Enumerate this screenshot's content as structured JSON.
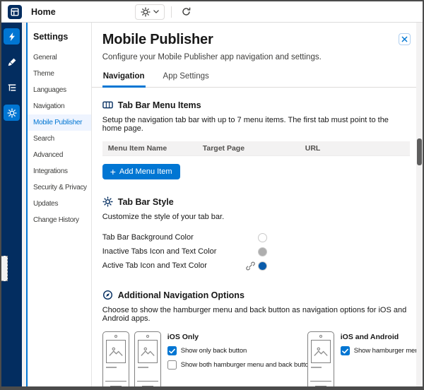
{
  "colors": {
    "brand_blue": "#0176D3",
    "navy": "#032D60",
    "selected_item_bg": "#EEF4FF"
  },
  "icons": {
    "plus": "+",
    "builder_logo": "grid-square",
    "topbar": [
      "gear",
      "chevron-down",
      "refresh-arrow"
    ],
    "rail": [
      "lightning",
      "brush",
      "page-structure",
      "gear"
    ],
    "sections": [
      "tab-bar",
      "gear-sun",
      "compass"
    ],
    "link": "chain",
    "close": "x"
  },
  "top_bar": {
    "home_label": "Home"
  },
  "sidebar": {
    "title": "Settings",
    "items": [
      {
        "label": "General"
      },
      {
        "label": "Theme"
      },
      {
        "label": "Languages"
      },
      {
        "label": "Navigation"
      },
      {
        "label": "Mobile Publisher",
        "active": true
      },
      {
        "label": "Search"
      },
      {
        "label": "Advanced"
      },
      {
        "label": "Integrations"
      },
      {
        "label": "Security & Privacy"
      },
      {
        "label": "Updates"
      },
      {
        "label": "Change History"
      }
    ]
  },
  "main": {
    "title": "Mobile Publisher",
    "subtitle": "Configure your Mobile Publisher app navigation and settings.",
    "tabs": [
      {
        "label": "Navigation",
        "active": true
      },
      {
        "label": "App Settings",
        "active": false
      }
    ],
    "menu_items_section": {
      "heading": "Tab Bar Menu Items",
      "description": "Setup the navigation tab bar with up to 7 menu items. The first tab must point to the home page.",
      "columns": [
        "Menu Item Name",
        "Target Page",
        "URL"
      ],
      "add_button_label": "Add Menu Item"
    },
    "style_section": {
      "heading": "Tab Bar Style",
      "description": "Customize the style of your tab bar.",
      "rows": [
        {
          "label": "Tab Bar Background Color",
          "color": "#FFFFFF",
          "linked": false
        },
        {
          "label": "Inactive Tabs Icon and Text Color",
          "color": "#AEAEAE",
          "linked": false
        },
        {
          "label": "Active Tab Icon and Text Color",
          "color": "#0B5CAB",
          "linked": true
        }
      ]
    },
    "nav_options_section": {
      "heading": "Additional Navigation Options",
      "description": "Choose to show the hamburger menu and back button as navigation options for iOS and Android apps.",
      "groups": [
        {
          "title": "iOS Only",
          "options": [
            {
              "label": "Show only back button",
              "checked": true
            },
            {
              "label": "Show both hamburger menu and back button",
              "checked": false
            }
          ]
        },
        {
          "title": "iOS and Android",
          "options": [
            {
              "label": "Show hamburger menu",
              "checked": true
            }
          ]
        }
      ]
    }
  }
}
